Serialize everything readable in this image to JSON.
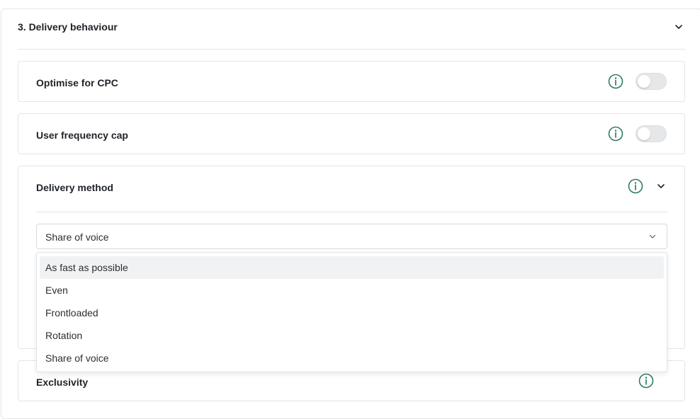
{
  "section": {
    "title": "3. Delivery behaviour"
  },
  "cards": {
    "optimise_cpc": {
      "label": "Optimise for CPC",
      "enabled": false
    },
    "frequency_cap": {
      "label": "User frequency cap",
      "enabled": false
    },
    "delivery_method": {
      "label": "Delivery method",
      "selected": "Share of voice",
      "options": [
        "As fast as possible",
        "Even",
        "Frontloaded",
        "Rotation",
        "Share of voice"
      ],
      "highlighted_option": "As fast as possible"
    },
    "exclusivity": {
      "label": "Exclusivity"
    }
  },
  "colors": {
    "info_icon": "#2f7d5f",
    "border": "#e3e5e8",
    "toggle_off": "#e6e7e9",
    "option_hover": "#f1f2f3"
  },
  "icons": {
    "info": "info-circle-icon",
    "chevron": "chevron-down-icon"
  }
}
